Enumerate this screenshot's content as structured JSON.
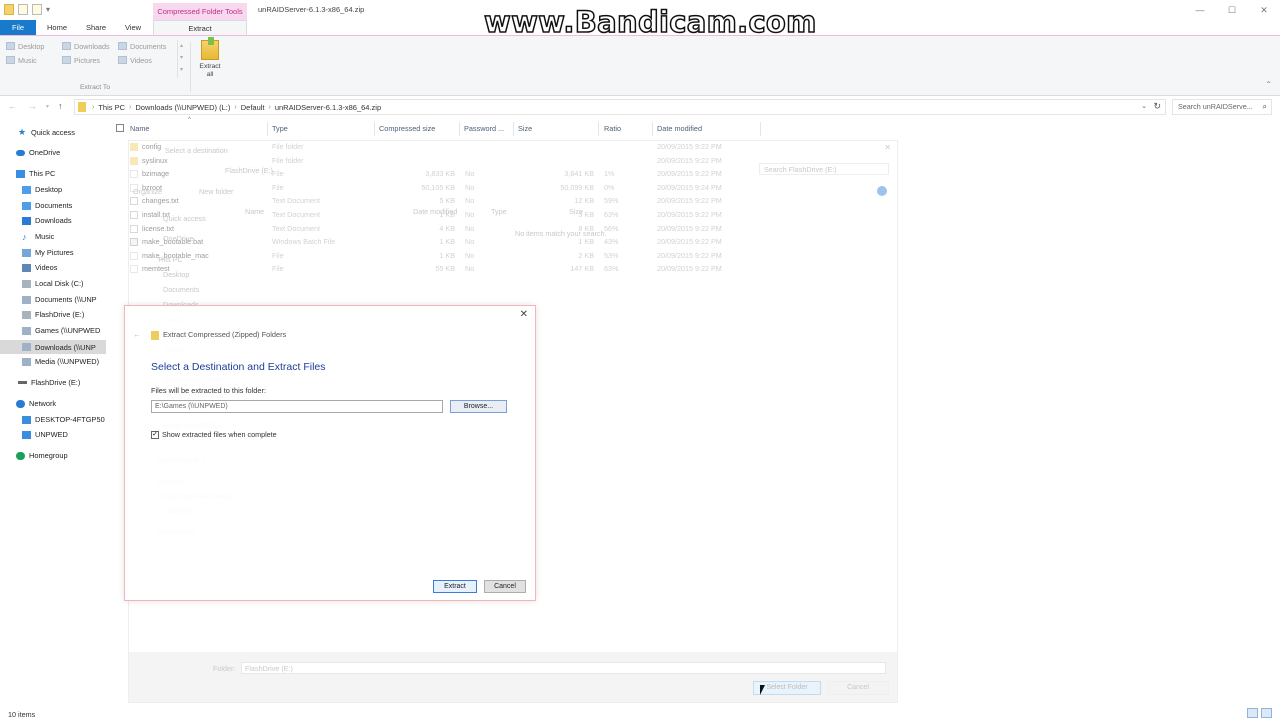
{
  "watermark": "www.Bandicam.com",
  "window": {
    "title": "unRAIDServer-6.1.3-x86_64.zip",
    "context_tab_header": "Compressed Folder Tools",
    "minimize": "—",
    "maximize": "☐",
    "close": "✕"
  },
  "ribbon": {
    "tabs": [
      "File",
      "Home",
      "Share",
      "View",
      "Extract"
    ],
    "destinations": [
      "Desktop",
      "Downloads",
      "Documents",
      "Music",
      "Pictures",
      "Videos"
    ],
    "group_label": "Extract To",
    "extract_all_line1": "Extract",
    "extract_all_line2": "all"
  },
  "address": {
    "crumbs": [
      "This PC",
      "Downloads (\\\\UNPWED) (L:)",
      "Default",
      "unRAIDServer-6.1.3-x86_64.zip"
    ],
    "search_placeholder": "Search unRAIDServe..."
  },
  "nav": {
    "items": [
      "Quick access",
      "OneDrive",
      "This PC",
      "Desktop",
      "Documents",
      "Downloads",
      "Music",
      "My Pictures",
      "Videos",
      "Local Disk (C:)",
      "Documents (\\\\UNP",
      "FlashDrive (E:)",
      "Games (\\\\UNPWED",
      "Downloads (\\\\UNP",
      "Media (\\\\UNPWED)",
      "FlashDrive (E:)",
      "Network",
      "DESKTOP-4FTGP50",
      "UNPWED",
      "Homegroup"
    ]
  },
  "list": {
    "columns": [
      "Name",
      "Type",
      "Compressed size",
      "Password ...",
      "Size",
      "Ratio",
      "Date modified"
    ],
    "rows": [
      {
        "name": "config",
        "type": "File folder",
        "csize": "",
        "pw": "",
        "size": "",
        "ratio": "",
        "date": "20/09/2015 9:22 PM",
        "icon": "fold"
      },
      {
        "name": "syslinux",
        "type": "File folder",
        "csize": "",
        "pw": "",
        "size": "",
        "ratio": "",
        "date": "20/09/2015 9:22 PM",
        "icon": "fold"
      },
      {
        "name": "bzimage",
        "type": "File",
        "csize": "3,833 KB",
        "pw": "No",
        "size": "3,841 KB",
        "ratio": "1%",
        "date": "20/09/2015 9:22 PM",
        "icon": "file"
      },
      {
        "name": "bzroot",
        "type": "File",
        "csize": "50,105 KB",
        "pw": "No",
        "size": "50,099 KB",
        "ratio": "0%",
        "date": "20/09/2015 9:24 PM",
        "icon": "file"
      },
      {
        "name": "changes.txt",
        "type": "Text Document",
        "csize": "5 KB",
        "pw": "No",
        "size": "12 KB",
        "ratio": "59%",
        "date": "20/09/2015 9:22 PM",
        "icon": "txt"
      },
      {
        "name": "install.txt",
        "type": "Text Document",
        "csize": "1 KB",
        "pw": "No",
        "size": "3 KB",
        "ratio": "63%",
        "date": "20/09/2015 9:22 PM",
        "icon": "txt"
      },
      {
        "name": "license.txt",
        "type": "Text Document",
        "csize": "4 KB",
        "pw": "No",
        "size": "8 KB",
        "ratio": "56%",
        "date": "20/09/2015 9:22 PM",
        "icon": "txt"
      },
      {
        "name": "make_bootable.bat",
        "type": "Windows Batch File",
        "csize": "1 KB",
        "pw": "No",
        "size": "1 KB",
        "ratio": "43%",
        "date": "20/09/2015 9:22 PM",
        "icon": "bat"
      },
      {
        "name": "make_bootable_mac",
        "type": "File",
        "csize": "1 KB",
        "pw": "No",
        "size": "2 KB",
        "ratio": "53%",
        "date": "20/09/2015 9:22 PM",
        "icon": "file"
      },
      {
        "name": "memtest",
        "type": "File",
        "csize": "55 KB",
        "pw": "No",
        "size": "147 KB",
        "ratio": "63%",
        "date": "20/09/2015 9:22 PM",
        "icon": "file"
      }
    ]
  },
  "ghost": {
    "title": "Select a destination",
    "path": "FlashDrive (E:)",
    "search": "Search FlashDrive (E:)",
    "new_folder": "New folder",
    "organize": "Organize",
    "col_name": "Name",
    "col_date": "Date modified",
    "col_type": "Type",
    "col_size": "Size",
    "empty": "No items match your search.",
    "nav_items": [
      "Quick access",
      "OneDrive",
      "This PC",
      "Desktop",
      "Documents",
      "Downloads",
      "Music",
      "My Pictures",
      "Videos",
      "Local Disk (C:)",
      "Documents (\\\\UNP",
      "Games (\\\\UNPWED",
      "Downloads (\\\\UNP",
      "Media (\\\\UNPWED",
      "FlashDrive (E:)",
      "Network",
      "DESKTOP-4FTGP50",
      "UNPWED",
      "Homegroup"
    ],
    "folder_label": "Folder:",
    "folder_value": "FlashDrive (E:)",
    "select_folder": "Select Folder",
    "cancel": "Cancel"
  },
  "dialog": {
    "caption": "Extract Compressed (Zipped) Folders",
    "heading": "Select a Destination and Extract Files",
    "label": "Files will be extracted to this folder:",
    "path": "E:\\Games (\\\\UNPWED)",
    "browse": "Browse...",
    "checkbox_label": "Show extracted files when complete",
    "checked": true,
    "extract": "Extract",
    "cancel": "Cancel",
    "close": "✕"
  },
  "status": {
    "item_count": "10 items"
  }
}
